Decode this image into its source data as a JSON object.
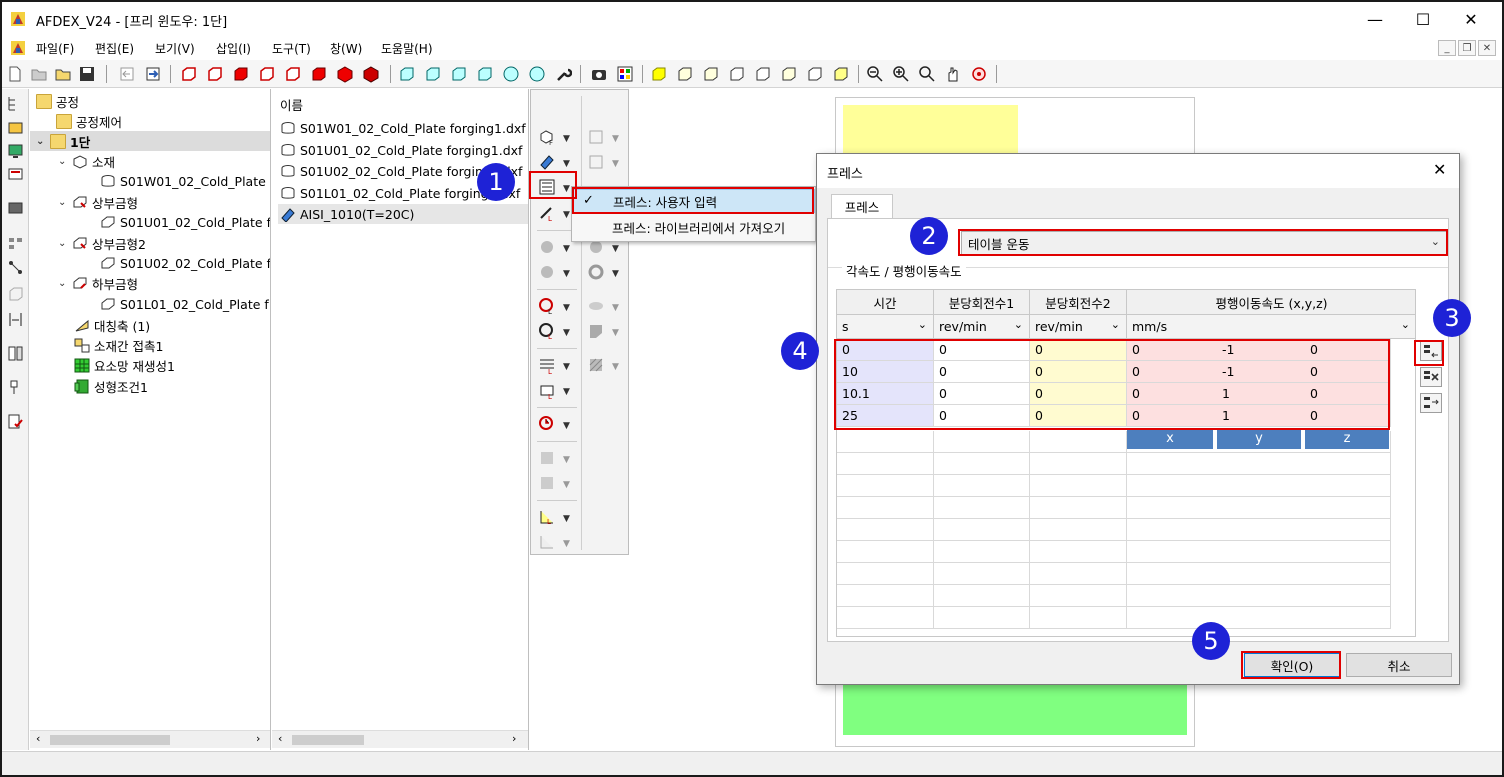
{
  "window": {
    "title": "AFDEX_V24 - [프리 윈도우: 1단]",
    "minimize": "—",
    "maximize": "☐",
    "close": "✕"
  },
  "menu": [
    "파일(F)",
    "편집(E)",
    "보기(V)",
    "삽입(I)",
    "도구(T)",
    "창(W)",
    "도움말(H)"
  ],
  "tree": {
    "root": "공정",
    "items": [
      {
        "label": "공정제어",
        "icon": "folder-icon"
      },
      {
        "label": "1단",
        "icon": "folder-open-icon"
      },
      {
        "label": "소재",
        "icon": "workpiece-icon"
      },
      {
        "label": "S01W01_02_Cold_Plate",
        "icon": "mesh-icon"
      },
      {
        "label": "상부금형",
        "icon": "upper-die-icon"
      },
      {
        "label": "S01U01_02_Cold_Plate f",
        "icon": "mesh-icon"
      },
      {
        "label": "상부금형2",
        "icon": "upper-die-icon"
      },
      {
        "label": "S01U02_02_Cold_Plate f",
        "icon": "mesh-icon"
      },
      {
        "label": "하부금형",
        "icon": "lower-die-icon"
      },
      {
        "label": "S01L01_02_Cold_Plate f",
        "icon": "mesh-icon"
      },
      {
        "label": "대칭축 (1)",
        "icon": "symmetry-icon"
      },
      {
        "label": "소재간 접촉1",
        "icon": "contact-icon"
      },
      {
        "label": "요소망 재생성1",
        "icon": "remesh-icon"
      },
      {
        "label": "성형조건1",
        "icon": "condition-icon"
      }
    ]
  },
  "list": {
    "header": "이름",
    "items": [
      "S01W01_02_Cold_Plate forging1.dxf",
      "S01U01_02_Cold_Plate forging1.dxf",
      "S01U02_02_Cold_Plate forging1.dxf",
      "S01L01_02_Cold_Plate forging1.dxf",
      "AISI_1010(T=20C)"
    ]
  },
  "context_menu": {
    "items": [
      "프레스: 사용자 입력",
      "프레스: 라이브러리에서 가져오기"
    ],
    "checked_index": 0
  },
  "dialog": {
    "title": "프레스",
    "tab": "프레스",
    "motion_type": "테이블 운동",
    "group_label": "각속도 / 평행이동속도",
    "columns": [
      "시간",
      "분당회전수1",
      "분당회전수2",
      "평행이동속도 (x,y,z)"
    ],
    "units": [
      "s",
      "rev/min",
      "rev/min",
      "mm/s"
    ],
    "rows": [
      [
        "0",
        "0",
        "0",
        "0",
        "-1",
        "0"
      ],
      [
        "10",
        "0",
        "0",
        "0",
        "-1",
        "0"
      ],
      [
        "10.1",
        "0",
        "0",
        "0",
        "1",
        "0"
      ],
      [
        "25",
        "0",
        "0",
        "0",
        "1",
        "0"
      ]
    ],
    "xyz_labels": [
      "x",
      "y",
      "z"
    ],
    "ok": "확인(O)",
    "cancel": "취소"
  },
  "badges": [
    "1",
    "2",
    "3",
    "4",
    "5"
  ],
  "colors": {
    "accent_red": "#e00000",
    "badge_blue": "#1e22d6",
    "time_col": "#e4e4fb",
    "rpm2_col": "#fffbd0",
    "velocity_col": "#fde0e0",
    "xyz_header": "#4d7fbe",
    "canvas_yellow": "#ffff99",
    "canvas_green": "#80ff80"
  }
}
